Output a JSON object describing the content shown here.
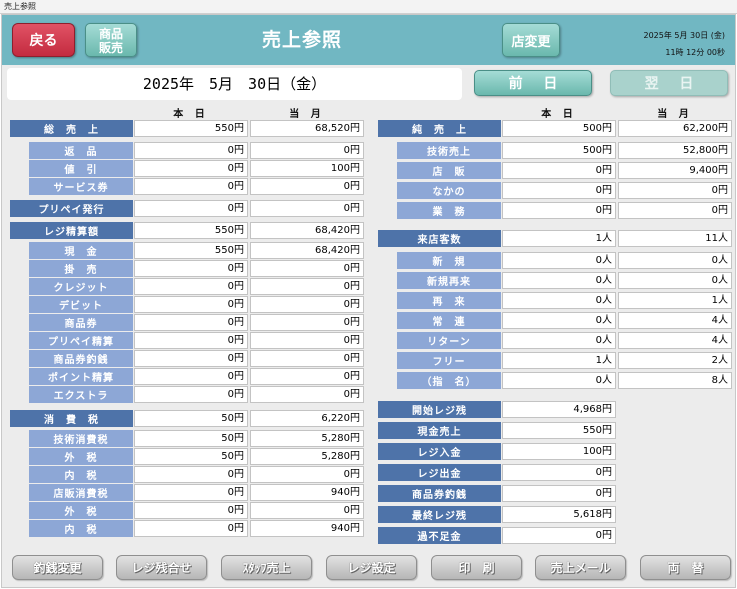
{
  "window_title": "売上参照",
  "header": {
    "back_label": "戻る",
    "goods_label_l1": "商品",
    "goods_label_l2": "販売",
    "title": "売上参照",
    "store_change_label": "店変更",
    "date": "2025年 5月 30日 (金)",
    "time": "11時 12分 00秒"
  },
  "date_bar": {
    "date": "2025年　5月　30日（金）",
    "prev_label": "前 日",
    "next_label": "翌 日"
  },
  "columns": {
    "today": "本 日",
    "month": "当 月"
  },
  "left_rows": [
    {
      "label": "総　売　上",
      "type": "main",
      "today": "550円",
      "month": "68,520円"
    },
    {
      "label": "返　品",
      "type": "sub",
      "today": "0円",
      "month": "0円"
    },
    {
      "label": "値　引",
      "type": "sub",
      "today": "0円",
      "month": "100円"
    },
    {
      "label": "サービス券",
      "type": "sub",
      "today": "0円",
      "month": "0円"
    },
    {
      "label": "プリペイ発行",
      "type": "main",
      "today": "0円",
      "month": "0円"
    },
    {
      "label": "レジ精算額",
      "type": "main",
      "today": "550円",
      "month": "68,420円"
    },
    {
      "label": "現　金",
      "type": "sub",
      "today": "550円",
      "month": "68,420円"
    },
    {
      "label": "掛　売",
      "type": "sub",
      "today": "0円",
      "month": "0円"
    },
    {
      "label": "クレジット",
      "type": "sub",
      "today": "0円",
      "month": "0円"
    },
    {
      "label": "デビット",
      "type": "sub",
      "today": "0円",
      "month": "0円"
    },
    {
      "label": "商品券",
      "type": "sub",
      "today": "0円",
      "month": "0円"
    },
    {
      "label": "プリペイ精算",
      "type": "sub",
      "today": "0円",
      "month": "0円"
    },
    {
      "label": "商品券釣銭",
      "type": "sub",
      "today": "0円",
      "month": "0円"
    },
    {
      "label": "ポイント精算",
      "type": "sub",
      "today": "0円",
      "month": "0円"
    },
    {
      "label": "エクストラ",
      "type": "sub",
      "today": "0円",
      "month": "0円"
    },
    {
      "label": "消　費　税",
      "type": "main",
      "today": "50円",
      "month": "6,220円"
    },
    {
      "label": "技術消費税",
      "type": "sub",
      "today": "50円",
      "month": "5,280円"
    },
    {
      "label": "外　税",
      "type": "sub",
      "today": "50円",
      "month": "5,280円"
    },
    {
      "label": "内　税",
      "type": "sub",
      "today": "0円",
      "month": "0円"
    },
    {
      "label": "店販消費税",
      "type": "sub",
      "today": "0円",
      "month": "940円"
    },
    {
      "label": "外　税",
      "type": "sub",
      "today": "0円",
      "month": "0円"
    },
    {
      "label": "内　税",
      "type": "sub",
      "today": "0円",
      "month": "940円"
    }
  ],
  "right_rows": [
    {
      "label": "純　売　上",
      "type": "main",
      "today": "500円",
      "month": "62,200円"
    },
    {
      "label": "技術売上",
      "type": "sub",
      "today": "500円",
      "month": "52,800円"
    },
    {
      "label": "店　販",
      "type": "sub",
      "today": "0円",
      "month": "9,400円"
    },
    {
      "label": "なかの",
      "type": "sub",
      "today": "0円",
      "month": "0円"
    },
    {
      "label": "業　務",
      "type": "sub",
      "today": "0円",
      "month": "0円"
    },
    {
      "label": "来店客数",
      "type": "main",
      "today": "1人",
      "month": "11人"
    },
    {
      "label": "新　規",
      "type": "sub",
      "today": "0人",
      "month": "0人"
    },
    {
      "label": "新規再来",
      "type": "sub",
      "today": "0人",
      "month": "0人"
    },
    {
      "label": "再　来",
      "type": "sub",
      "today": "0人",
      "month": "1人"
    },
    {
      "label": "常　連",
      "type": "sub",
      "today": "0人",
      "month": "4人"
    },
    {
      "label": "リターン",
      "type": "sub",
      "today": "0人",
      "month": "4人"
    },
    {
      "label": "フリー",
      "type": "sub",
      "today": "1人",
      "month": "2人"
    },
    {
      "label": "（指　名）",
      "type": "sub",
      "today": "0人",
      "month": "8人"
    }
  ],
  "register_rows": [
    {
      "label": "開始レジ残",
      "value": "4,968円"
    },
    {
      "label": "現金売上",
      "value": "550円"
    },
    {
      "label": "レジ入金",
      "value": "100円"
    },
    {
      "label": "レジ出金",
      "value": "0円"
    },
    {
      "label": "商品券釣銭",
      "value": "0円"
    },
    {
      "label": "最終レジ残",
      "value": "5,618円"
    },
    {
      "label": "過不足金",
      "value": "0円"
    }
  ],
  "bottom_buttons": [
    "釣銭変更",
    "レジ残合せ",
    "ｽﾀｯﾌ売上",
    "レジ設定",
    "印　刷",
    "売上メール",
    "両　替"
  ]
}
